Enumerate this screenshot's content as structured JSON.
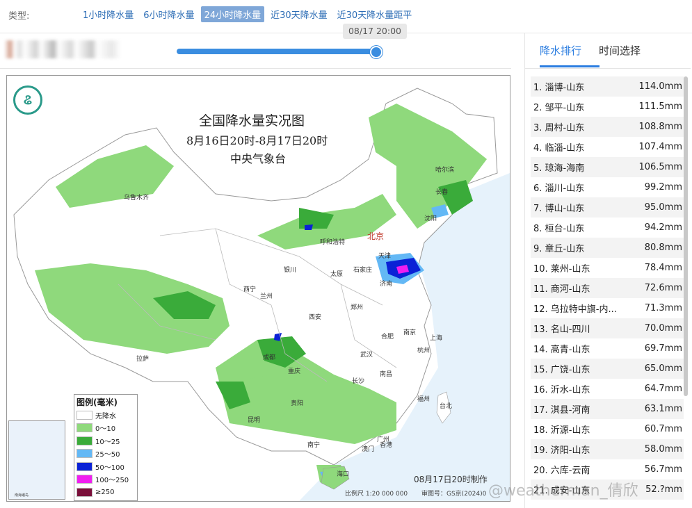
{
  "type_bar": {
    "label": "类型:",
    "tabs": [
      {
        "label": "1小时降水量",
        "active": false
      },
      {
        "label": "6小时降水量",
        "active": false
      },
      {
        "label": "24小时降水量",
        "active": true
      },
      {
        "label": "近30天降水量",
        "active": false
      },
      {
        "label": "近30天降水量距平",
        "active": false
      }
    ]
  },
  "timeline": {
    "current_time": "08/17 20:00",
    "progress": 1.0
  },
  "map": {
    "title": "全国降水量实况图",
    "subtitle": "8月16日20时-8月17日20时",
    "org": "中央气象台",
    "made_by": "08月17日20时制作",
    "scale": "比例尺 1:20 000 000",
    "review": "审图号：GS京(2024)0",
    "inset_label": "南海诸岛",
    "legend": {
      "title": "图例(毫米)",
      "items": [
        {
          "label": "无降水",
          "color": "#ffffff"
        },
        {
          "label": "0～10",
          "color": "#8fd97c"
        },
        {
          "label": "10～25",
          "color": "#3aab3a"
        },
        {
          "label": "25～50",
          "color": "#63b8f5"
        },
        {
          "label": "50～100",
          "color": "#0b22d6"
        },
        {
          "label": "100～250",
          "color": "#f01ef0"
        },
        {
          "label": "≥250",
          "color": "#7a0f3a"
        }
      ]
    },
    "cities": {
      "beijing": "北京",
      "urumqi": "乌鲁木齐",
      "harbin": "哈尔滨",
      "changchun": "长春",
      "shenyang": "沈阳",
      "hohhot": "呼和浩特",
      "tianjin": "天津",
      "shijiazhuang": "石家庄",
      "taiyuan": "太原",
      "jinan": "济南",
      "yinchuan": "银川",
      "xining": "西宁",
      "lanzhou": "兰州",
      "xian": "西安",
      "zhengzhou": "郑州",
      "hefei": "合肥",
      "nanjing": "南京",
      "shanghai": "上海",
      "wuhan": "武汉",
      "hangzhou": "杭州",
      "lhasa": "拉萨",
      "chengdu": "成都",
      "chongqing": "重庆",
      "changsha": "长沙",
      "nanchang": "南昌",
      "fuzhou": "福州",
      "taibei": "台北",
      "guiyang": "贵阳",
      "kunming": "昆明",
      "nanning": "南宁",
      "guangzhou": "广州",
      "aomen": "澳门",
      "xianggang": "香港",
      "haikou": "海口"
    }
  },
  "panel": {
    "tabs": [
      {
        "label": "降水排行",
        "active": true
      },
      {
        "label": "时间选择",
        "active": false
      }
    ],
    "ranking": [
      {
        "name": "1. 淄博-山东",
        "value": "114.0mm"
      },
      {
        "name": "2. 邹平-山东",
        "value": "111.5mm"
      },
      {
        "name": "3. 周村-山东",
        "value": "108.8mm"
      },
      {
        "name": "4. 临淄-山东",
        "value": "107.4mm"
      },
      {
        "name": "5. 琼海-海南",
        "value": "106.5mm"
      },
      {
        "name": "6. 淄川-山东",
        "value": "99.2mm"
      },
      {
        "name": "7. 博山-山东",
        "value": "95.0mm"
      },
      {
        "name": "8. 桓台-山东",
        "value": "94.2mm"
      },
      {
        "name": "9. 章丘-山东",
        "value": "80.8mm"
      },
      {
        "name": "10. 莱州-山东",
        "value": "78.4mm"
      },
      {
        "name": "11. 商河-山东",
        "value": "72.6mm"
      },
      {
        "name": "12. 乌拉特中旗-内...",
        "value": "71.3mm"
      },
      {
        "name": "13. 名山-四川",
        "value": "70.0mm"
      },
      {
        "name": "14. 高青-山东",
        "value": "69.7mm"
      },
      {
        "name": "15. 广饶-山东",
        "value": "65.0mm"
      },
      {
        "name": "16. 沂水-山东",
        "value": "64.7mm"
      },
      {
        "name": "17. 淇县-河南",
        "value": "63.1mm"
      },
      {
        "name": "18. 沂源-山东",
        "value": "60.7mm"
      },
      {
        "name": "19. 济阳-山东",
        "value": "58.0mm"
      },
      {
        "name": "20. 六库-云南",
        "value": "56.7mm"
      },
      {
        "name": "21. 成安-山东",
        "value": "52.?mm"
      }
    ]
  },
  "watermark": "@weatherman_倩欣"
}
